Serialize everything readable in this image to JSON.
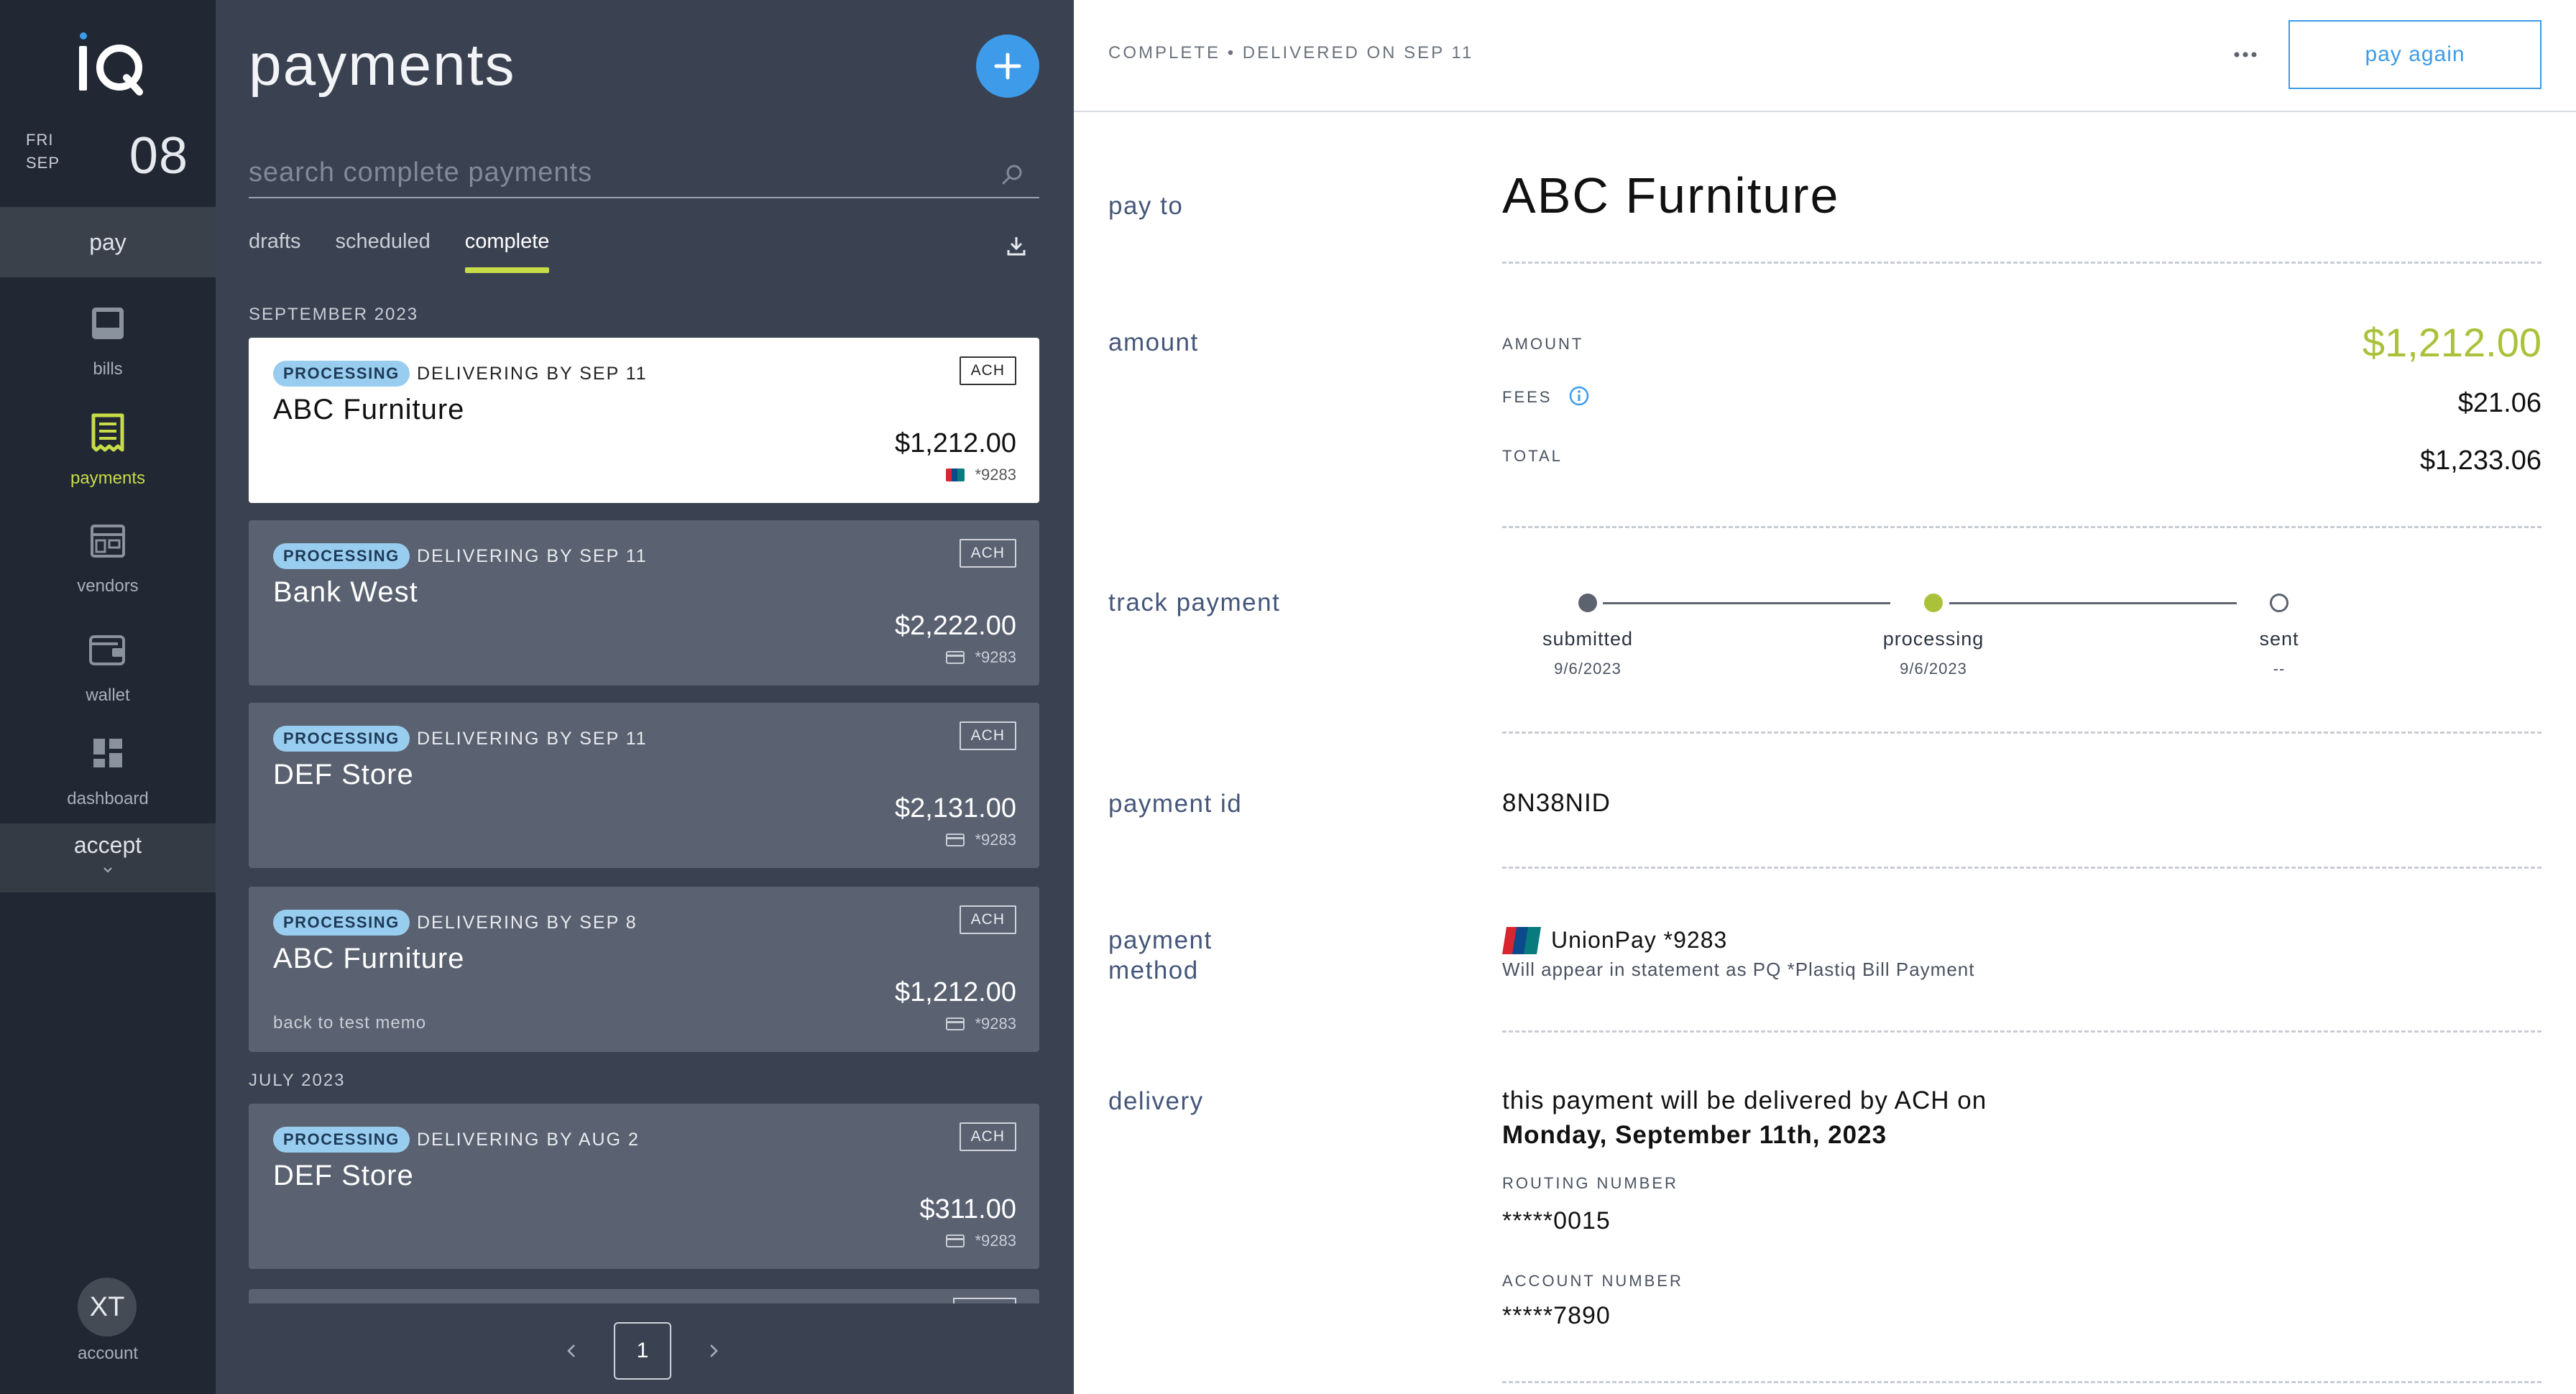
{
  "nav": {
    "date": {
      "dow": "FRI",
      "month": "SEP",
      "day": "08"
    },
    "pay_label": "pay",
    "items": [
      {
        "label": "bills",
        "icon": "inbox-icon"
      },
      {
        "label": "payments",
        "icon": "receipt-icon"
      },
      {
        "label": "vendors",
        "icon": "storefront-icon"
      },
      {
        "label": "wallet",
        "icon": "wallet-icon"
      },
      {
        "label": "dashboard",
        "icon": "dashboard-icon"
      }
    ],
    "accept_label": "accept",
    "avatar_initials": "XT",
    "account_label": "account"
  },
  "list": {
    "title": "payments",
    "search_placeholder": "search complete payments",
    "tabs": [
      {
        "label": "drafts"
      },
      {
        "label": "scheduled"
      },
      {
        "label": "complete",
        "active": true
      }
    ],
    "sections": [
      {
        "header": "SEPTEMBER 2023",
        "cards": [
          {
            "badge": "PROCESSING",
            "delivery": "DELIVERING BY SEP 11",
            "method": "ACH",
            "vendor": "ABC Furniture",
            "amount": "$1,212.00",
            "card": "*9283",
            "memo": "",
            "selected": true
          },
          {
            "badge": "PROCESSING",
            "delivery": "DELIVERING BY SEP 11",
            "method": "ACH",
            "vendor": "Bank West",
            "amount": "$2,222.00",
            "card": "*9283",
            "memo": ""
          },
          {
            "badge": "PROCESSING",
            "delivery": "DELIVERING BY SEP 11",
            "method": "ACH",
            "vendor": "DEF Store",
            "amount": "$2,131.00",
            "card": "*9283",
            "memo": ""
          },
          {
            "badge": "PROCESSING",
            "delivery": "DELIVERING BY SEP 8",
            "method": "ACH",
            "vendor": "ABC Furniture",
            "amount": "$1,212.00",
            "card": "*9283",
            "memo": "back to test memo"
          }
        ]
      },
      {
        "header": "JULY 2023",
        "cards": [
          {
            "badge": "PROCESSING",
            "delivery": "DELIVERING BY AUG 2",
            "method": "ACH",
            "vendor": "DEF Store",
            "amount": "$311.00",
            "card": "*9283",
            "memo": ""
          }
        ]
      }
    ],
    "page": "1"
  },
  "detail": {
    "status": "COMPLETE • DELIVERED ON SEP 11",
    "pay_again_label": "pay again",
    "pay_to": {
      "label": "pay to",
      "value": "ABC Furniture"
    },
    "amount": {
      "label": "amount",
      "amount_caption": "AMOUNT",
      "amount_value": "$1,212.00",
      "fees_caption": "FEES",
      "fees_value": "$21.06",
      "total_caption": "TOTAL",
      "total_value": "$1,233.06"
    },
    "track": {
      "label": "track payment",
      "steps": [
        {
          "name": "submitted",
          "date": "9/6/2023"
        },
        {
          "name": "processing",
          "date": "9/6/2023"
        },
        {
          "name": "sent",
          "date": "--"
        }
      ]
    },
    "payment_id": {
      "label": "payment id",
      "value": "8N38NID"
    },
    "payment_method": {
      "label_line1": "payment",
      "label_line2": "method",
      "name": "UnionPay *9283",
      "note": "Will appear in statement as PQ *Plastiq Bill Payment"
    },
    "delivery": {
      "label": "delivery",
      "line1": "this payment will be delivered by ACH on",
      "line2": "Monday, September 11th, 2023",
      "routing_caption": "ROUTING NUMBER",
      "routing_value": "*****0015",
      "account_caption": "ACCOUNT NUMBER",
      "account_value": "*****7890"
    }
  },
  "colors": {
    "nav_bg": "#212733",
    "list_bg": "#3a4150",
    "card_bg": "#5a6170",
    "accent_green": "#c7dc46",
    "accent_blue": "#3d9be9",
    "amount_green": "#a9c23a",
    "badge_bg": "#99cdef"
  }
}
